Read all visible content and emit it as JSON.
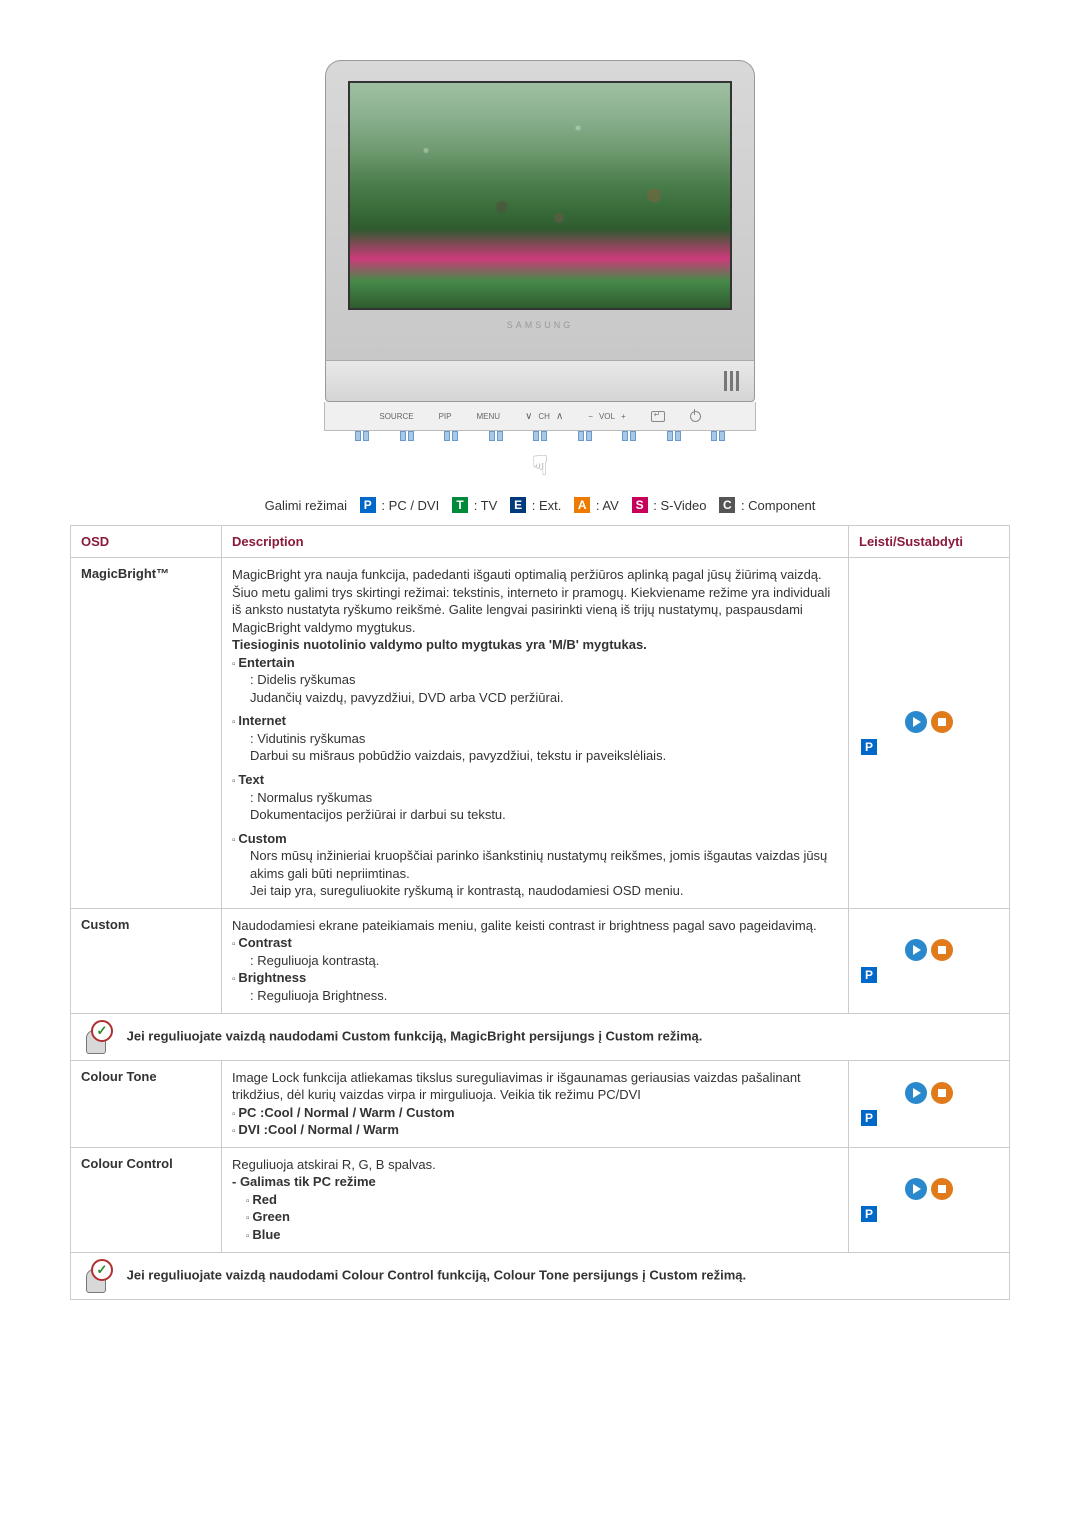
{
  "monitor": {
    "brand": "SAMSUNG"
  },
  "controls": {
    "source": "SOURCE",
    "pip": "PIP",
    "menu": "MENU",
    "ch": "CH",
    "vol": "VOL"
  },
  "legend": {
    "prefix": "Galimi režimai",
    "p": "P",
    "p_label": ": PC / DVI",
    "t": "T",
    "t_label": ": TV",
    "e": "E",
    "e_label": ": Ext.",
    "a": "A",
    "a_label": ": AV",
    "s": "S",
    "s_label": ": S-Video",
    "c": "C",
    "c_label": ": Component"
  },
  "headers": {
    "osd": "OSD",
    "description": "Description",
    "play": "Leisti/Sustabdyti"
  },
  "rows": {
    "magicbright": {
      "label": "MagicBright™",
      "intro": "MagicBright yra nauja funkcija, padedanti išgauti optimalią peržiūros aplinką pagal jūsų žiūrimą vaizdą. Šiuo metu galimi trys skirtingi režimai: tekstinis, interneto ir pramogų. Kiekviename režime yra individuali iš anksto nustatyta ryškumo reikšmė. Galite lengvai pasirinkti vieną iš trijų nustatymų, paspausdami MagicBright valdymo mygtukus.",
      "bold_line": "Tiesioginis nuotolinio valdymo pulto mygtukas yra 'M/B' mygtukas.",
      "entertain": {
        "title": "Entertain",
        "l1": ": Didelis ryškumas",
        "l2": "Judančių vaizdų, pavyzdžiui, DVD arba VCD peržiūrai."
      },
      "internet": {
        "title": "Internet",
        "l1": ": Vidutinis ryškumas",
        "l2": "Darbui su mišraus pobūdžio vaizdais, pavyzdžiui, tekstu ir paveikslėliais."
      },
      "text": {
        "title": "Text",
        "l1": ": Normalus ryškumas",
        "l2": "Dokumentacijos peržiūrai ir darbui su tekstu."
      },
      "custom": {
        "title": "Custom",
        "l1": "Nors mūsų inžinieriai kruopščiai parinko išankstinių nustatymų reikšmes, jomis išgautas vaizdas jūsų akims gali būti nepriimtinas.",
        "l2": "Jei taip yra, sureguliuokite ryškumą ir kontrastą, naudodamiesi OSD meniu."
      },
      "badge": "P"
    },
    "custom": {
      "label": "Custom",
      "intro": "Naudodamiesi ekrane pateikiamais meniu, galite keisti contrast ir brightness pagal savo pageidavimą.",
      "contrast": {
        "title": "Contrast",
        "l1": ": Reguliuoja kontrastą."
      },
      "brightness": {
        "title": "Brightness",
        "l1": ": Reguliuoja Brightness."
      },
      "badge": "P"
    },
    "note1": "Jei reguliuojate vaizdą naudodami Custom funkciją, MagicBright persijungs į Custom režimą.",
    "colourtone": {
      "label": "Colour Tone",
      "intro": "Image Lock funkcija atliekamas tikslus sureguliavimas ir išgaunamas geriausias vaizdas pašalinant trikdžius, dėl kurių vaizdas virpa ir mirguliuoja. Veikia tik režimu PC/DVI",
      "pc": "PC :Cool / Normal / Warm / Custom",
      "dvi": "DVI :Cool / Normal / Warm",
      "badge": "P"
    },
    "colourcontrol": {
      "label": "Colour Control",
      "l1": "Reguliuoja atskirai R, G, B spalvas.",
      "l2": "- Galimas tik PC režime",
      "red": "Red",
      "green": "Green",
      "blue": "Blue",
      "badge": "P"
    },
    "note2": "Jei reguliuojate vaizdą naudodami Colour Control funkciją, Colour Tone persijungs į Custom režimą."
  }
}
